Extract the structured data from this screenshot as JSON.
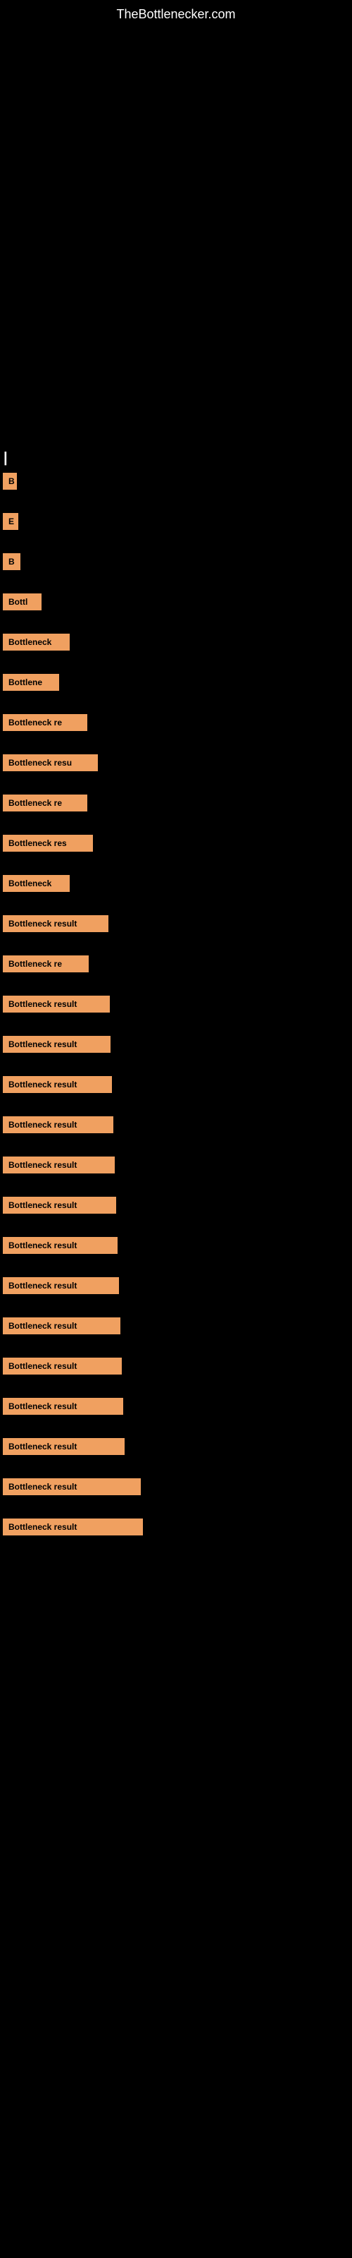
{
  "site": {
    "title": "TheBottlenecker.com"
  },
  "items": [
    {
      "id": 1,
      "label": "B",
      "width": 20
    },
    {
      "id": 2,
      "label": "E",
      "width": 22
    },
    {
      "id": 3,
      "label": "B",
      "width": 25
    },
    {
      "id": 4,
      "label": "Bottl",
      "width": 55
    },
    {
      "id": 5,
      "label": "Bottleneck",
      "width": 95
    },
    {
      "id": 6,
      "label": "Bottlene",
      "width": 80
    },
    {
      "id": 7,
      "label": "Bottleneck re",
      "width": 120
    },
    {
      "id": 8,
      "label": "Bottleneck resu",
      "width": 135
    },
    {
      "id": 9,
      "label": "Bottleneck re",
      "width": 120
    },
    {
      "id": 10,
      "label": "Bottleneck res",
      "width": 128
    },
    {
      "id": 11,
      "label": "Bottleneck",
      "width": 95
    },
    {
      "id": 12,
      "label": "Bottleneck result",
      "width": 150
    },
    {
      "id": 13,
      "label": "Bottleneck re",
      "width": 122
    },
    {
      "id": 14,
      "label": "Bottleneck result",
      "width": 152
    },
    {
      "id": 15,
      "label": "Bottleneck result",
      "width": 153
    },
    {
      "id": 16,
      "label": "Bottleneck result",
      "width": 155
    },
    {
      "id": 17,
      "label": "Bottleneck result",
      "width": 157
    },
    {
      "id": 18,
      "label": "Bottleneck result",
      "width": 159
    },
    {
      "id": 19,
      "label": "Bottleneck result",
      "width": 161
    },
    {
      "id": 20,
      "label": "Bottleneck result",
      "width": 163
    },
    {
      "id": 21,
      "label": "Bottleneck result",
      "width": 165
    },
    {
      "id": 22,
      "label": "Bottleneck result",
      "width": 167
    },
    {
      "id": 23,
      "label": "Bottleneck result",
      "width": 169
    },
    {
      "id": 24,
      "label": "Bottleneck result",
      "width": 171
    },
    {
      "id": 25,
      "label": "Bottleneck result",
      "width": 173
    },
    {
      "id": 26,
      "label": "Bottleneck result",
      "width": 196
    },
    {
      "id": 27,
      "label": "Bottleneck result",
      "width": 199
    }
  ],
  "colors": {
    "background": "#000000",
    "badge": "#f0a060",
    "badge_text": "#000000",
    "title_text": "#ffffff"
  }
}
